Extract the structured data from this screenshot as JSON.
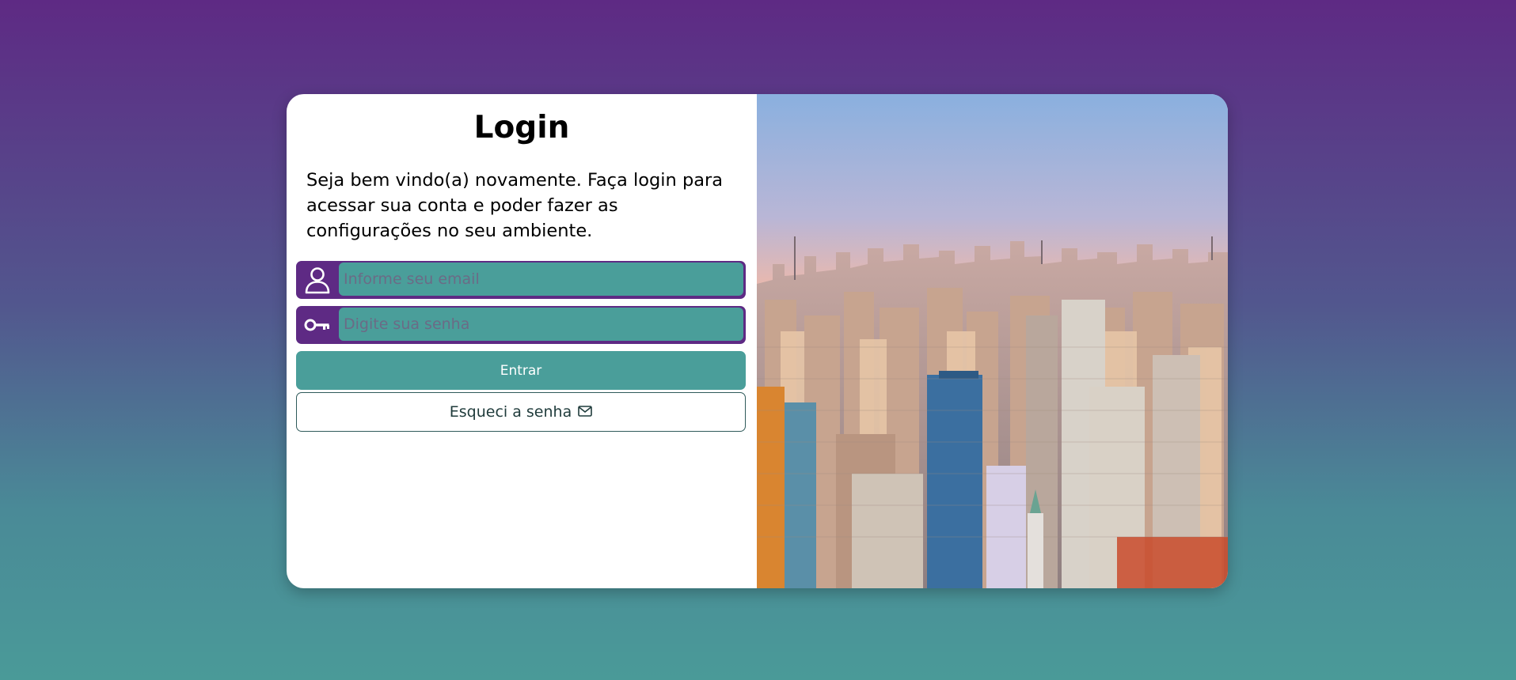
{
  "login": {
    "title": "Login",
    "intro": "Seja bem vindo(a) novamente. Faça login para acessar sua conta e poder fazer as configurações no seu ambiente.",
    "email": {
      "placeholder": "Informe seu email",
      "value": "",
      "icon": "user-icon"
    },
    "password": {
      "placeholder": "Digite sua senha",
      "value": "",
      "icon": "key-icon"
    },
    "submit_label": "Entrar",
    "forgot_label": "Esqueci a senha",
    "forgot_icon": "envelope-icon"
  },
  "colors": {
    "accent_purple": "#5e2a84",
    "accent_teal": "#4a9e9a",
    "background_top": "#5e2a84",
    "background_bottom": "#4a9a98"
  }
}
